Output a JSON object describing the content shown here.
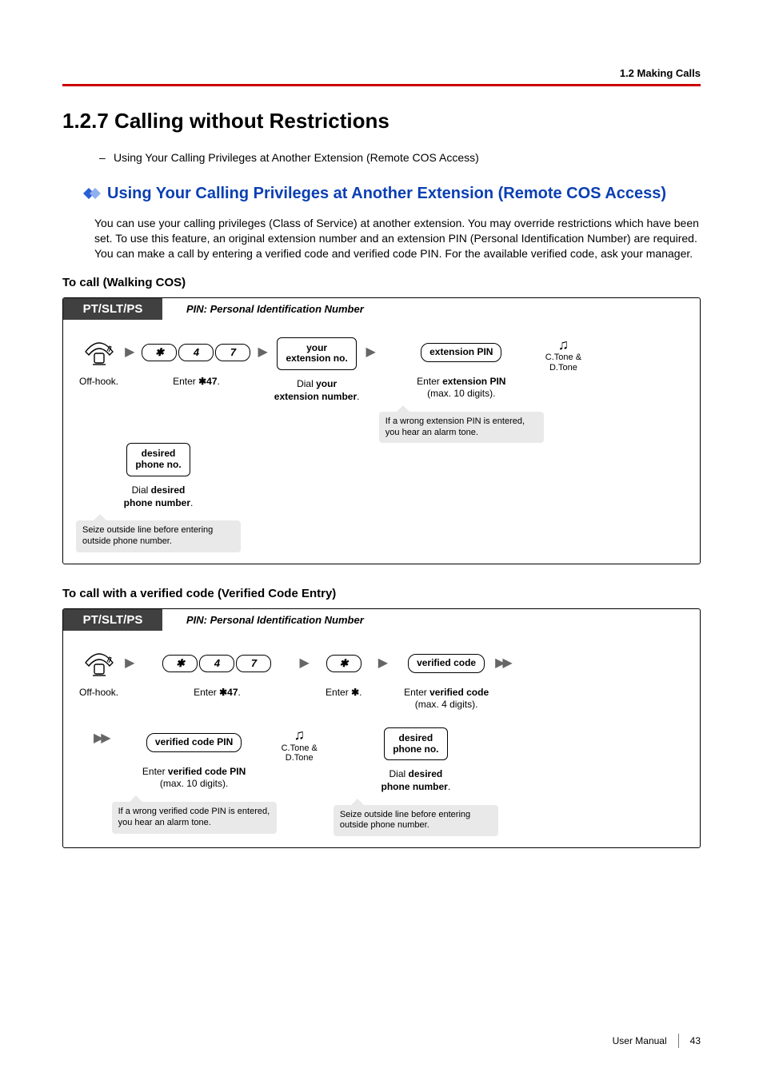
{
  "header": {
    "breadcrumb": "1.2 Making Calls"
  },
  "section": {
    "number_title": "1.2.7   Calling without Restrictions",
    "bullet": "Using Your Calling Privileges at Another Extension (Remote COS Access)"
  },
  "subsection": {
    "title": "Using Your Calling Privileges at Another Extension (Remote COS Access)",
    "paragraph": "You can use your calling privileges (Class of Service) at another extension. You may override restrictions which have been set. To use this feature, an original extension number and an extension PIN (Personal Identification Number) are required. You can make a call by entering a verified code and verified code PIN. For the available verified code, ask your manager."
  },
  "proc1": {
    "heading": "To call (Walking COS)",
    "tab": "PT/SLT/PS",
    "banner_note": "PIN: Personal Identification Number",
    "steps": {
      "offhook": "Off-hook.",
      "enter47_pre": "Enter ",
      "enter47_code": "47",
      "enter47_post": ".",
      "key_star": "✱",
      "key_4": "4",
      "key_7": "7",
      "your_ext_pill_l1": "your",
      "your_ext_pill_l2": "extension no.",
      "dial_your_l1": "Dial ",
      "dial_your_b": "your",
      "dial_your_l2": "extension number",
      "ext_pin_pill": "extension PIN",
      "enter_ext_pin_l1": "Enter ",
      "enter_ext_pin_b": "extension PIN",
      "enter_ext_pin_l2": "(max. 10 digits).",
      "tone_l1": "C.Tone &",
      "tone_l2": "D.Tone",
      "desired_pill_l1": "desired",
      "desired_pill_l2": "phone no.",
      "dial_desired_l1": "Dial ",
      "dial_desired_b": "desired",
      "dial_desired_l2": "phone number",
      "hint_pin": "If a wrong extension PIN is entered, you hear an alarm tone.",
      "hint_seize": "Seize outside line before entering outside phone number."
    }
  },
  "proc2": {
    "heading": "To call with a verified code (Verified Code Entry)",
    "tab": "PT/SLT/PS",
    "banner_note": "PIN: Personal Identification Number",
    "steps": {
      "offhook": "Off-hook.",
      "enter47_pre": "Enter ",
      "enter47_code": "47",
      "enter47_post": ".",
      "key_star": "✱",
      "key_4": "4",
      "key_7": "7",
      "enter_star_pre": "Enter ",
      "enter_star_post": ".",
      "vcode_pill": "verified code",
      "enter_vcode_l1": "Enter ",
      "enter_vcode_b": "verified code",
      "enter_vcode_l2": "(max. 4 digits).",
      "vcode_pin_pill": "verified code PIN",
      "enter_vpin_l1": "Enter ",
      "enter_vpin_b": "verified code PIN",
      "enter_vpin_l2": "(max. 10 digits).",
      "tone_l1": "C.Tone &",
      "tone_l2": "D.Tone",
      "desired_pill_l1": "desired",
      "desired_pill_l2": "phone no.",
      "dial_desired_l1": "Dial ",
      "dial_desired_b": "desired",
      "dial_desired_l2": "phone number",
      "hint_pin": "If a wrong verified code PIN is entered, you hear an alarm tone.",
      "hint_seize": "Seize outside line before entering outside phone number."
    }
  },
  "footer": {
    "manual": "User Manual",
    "page": "43"
  }
}
